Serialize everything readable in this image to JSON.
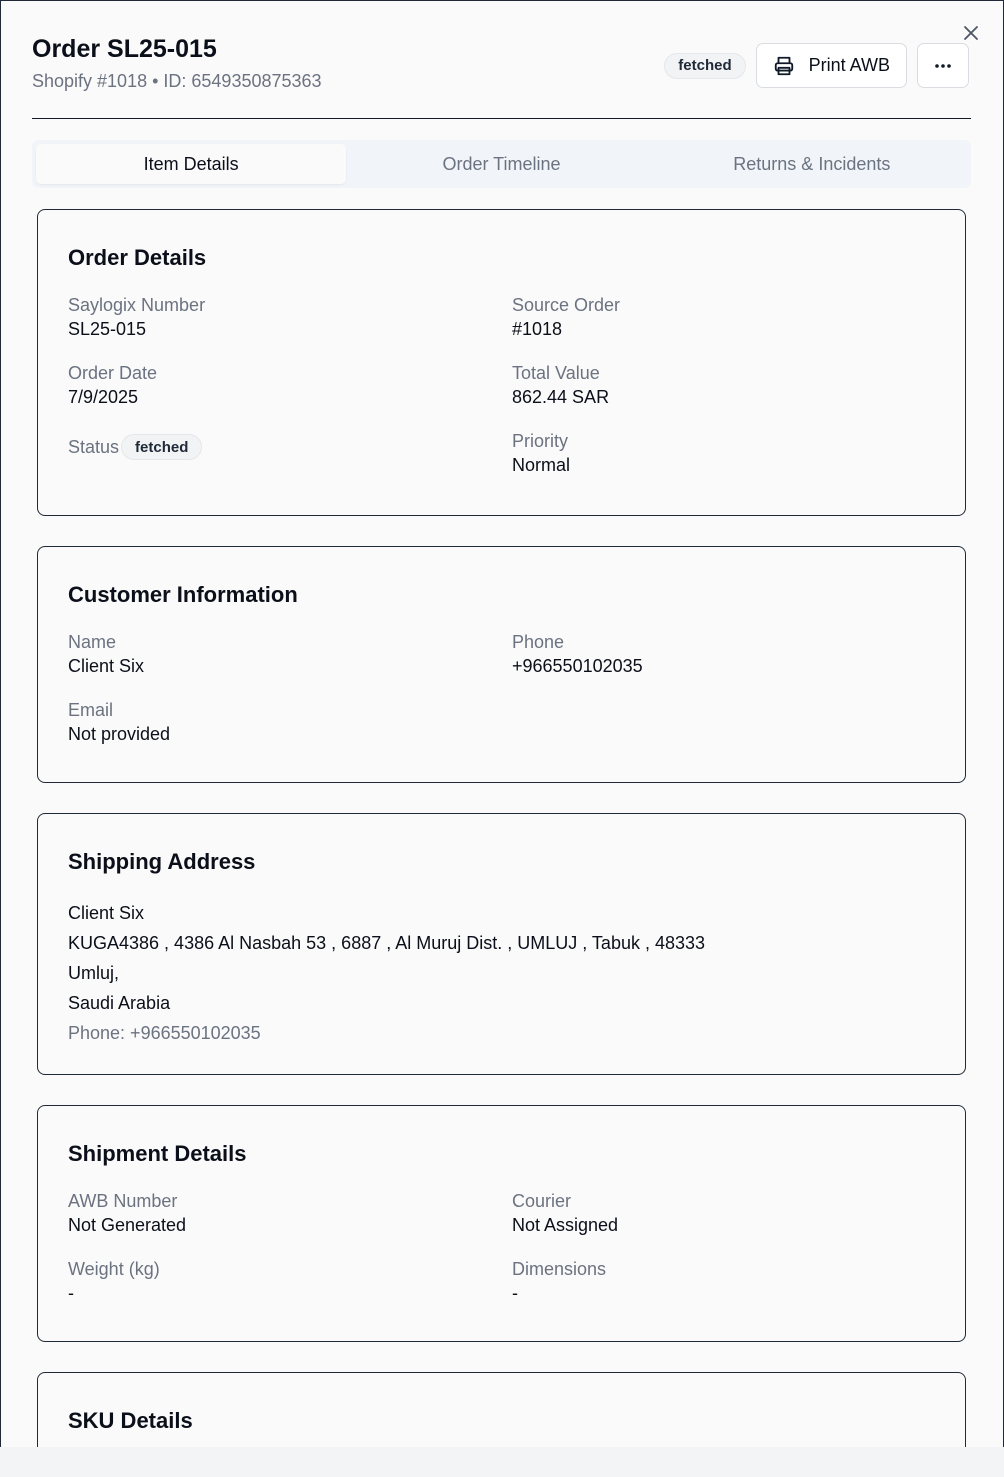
{
  "header": {
    "title": "Order SL25-015",
    "subtitle": "Shopify #1018 • ID: 6549350875363",
    "status_badge": "fetched",
    "print_label": "Print AWB",
    "more_icon": "more-horizontal-icon",
    "close_icon": "close-icon"
  },
  "tabs": [
    {
      "label": "Item Details",
      "active": true
    },
    {
      "label": "Order Timeline",
      "active": false
    },
    {
      "label": "Returns & Incidents",
      "active": false
    }
  ],
  "order_details": {
    "title": "Order Details",
    "saylogix_label": "Saylogix Number",
    "saylogix_value": "SL25-015",
    "source_label": "Source Order",
    "source_value": "#1018",
    "date_label": "Order Date",
    "date_value": "7/9/2025",
    "total_label": "Total Value",
    "total_value": "862.44 SAR",
    "status_label": "Status",
    "status_value": "fetched",
    "priority_label": "Priority",
    "priority_value": "Normal"
  },
  "customer": {
    "title": "Customer Information",
    "name_label": "Name",
    "name_value": "Client Six",
    "phone_label": "Phone",
    "phone_value": "+966550102035",
    "email_label": "Email",
    "email_value": "Not provided"
  },
  "shipping": {
    "title": "Shipping Address",
    "name": "Client Six",
    "line1": "KUGA4386 , 4386 Al Nasbah 53 , 6887 , Al Muruj Dist. , UMLUJ , Tabuk , 48333",
    "line2": "Umluj,",
    "line3": "Saudi Arabia",
    "phone": "Phone: +966550102035"
  },
  "shipment": {
    "title": "Shipment Details",
    "awb_label": "AWB Number",
    "awb_value": "Not Generated",
    "courier_label": "Courier",
    "courier_value": "Not Assigned",
    "weight_label": "Weight (kg)",
    "weight_value": "-",
    "dimensions_label": "Dimensions",
    "dimensions_value": "-"
  },
  "sku": {
    "title": "SKU Details"
  }
}
